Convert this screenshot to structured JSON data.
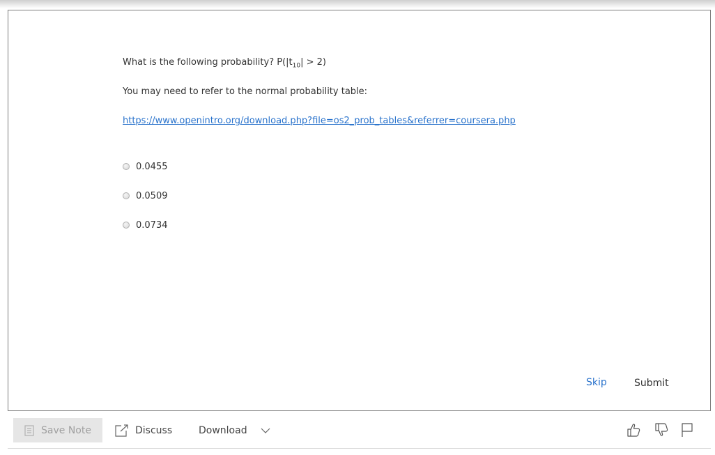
{
  "question": {
    "prompt_prefix": "What is the following probability? P(",
    "bar_left": "|",
    "variable": "t",
    "subscript": "10",
    "bar_right": "|",
    "prompt_suffix": " > 2)",
    "instruction": "You may need to refer to the normal probability table:",
    "link": "https://www.openintro.org/download.php?file=os2_prob_tables&referrer=coursera.php"
  },
  "options": [
    "0.0455",
    "0.0509",
    "0.0734"
  ],
  "actions": {
    "skip": "Skip",
    "submit": "Submit"
  },
  "toolbar": {
    "save_note": "Save Note",
    "discuss": "Discuss",
    "download": "Download"
  },
  "icons": {
    "save_note": "note-icon",
    "discuss": "external-link-icon",
    "download_menu": "chevron-down-icon",
    "like": "thumbs-up-icon",
    "dislike": "thumbs-down-icon",
    "flag": "flag-icon"
  },
  "colors": {
    "link": "#2a73cc",
    "text": "#333333",
    "save_note_bg": "#e6e6e6",
    "frame_border": "#7a7a7a"
  }
}
